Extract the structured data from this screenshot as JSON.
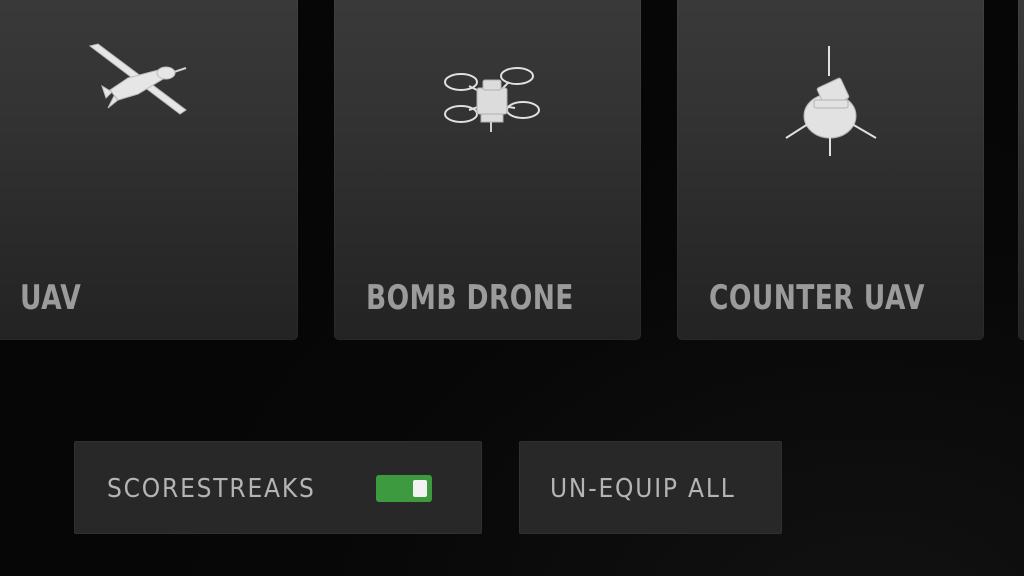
{
  "killstreaks": [
    {
      "name": "UAV",
      "icon": "uav-drone-icon"
    },
    {
      "name": "BOMB DRONE",
      "icon": "bomb-drone-icon"
    },
    {
      "name": "COUNTER UAV",
      "icon": "counter-uav-icon"
    }
  ],
  "controls": {
    "scorestreaks_label": "SCORESTREAKS",
    "scorestreaks_enabled": true,
    "unequip_label": "UN-EQUIP ALL"
  },
  "colors": {
    "toggle_on": "#3e9a3e",
    "card_label": "#9b9b9b",
    "button_text": "#b4b4b4"
  }
}
